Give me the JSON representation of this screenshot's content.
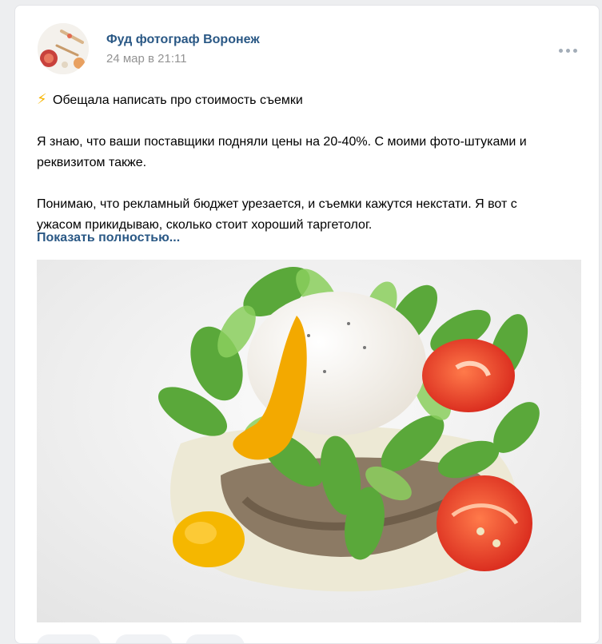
{
  "post": {
    "author": "Фуд фотограф Воронеж",
    "date": "24 мар в 21:11",
    "headline_emoji": "⚡",
    "lines": {
      "headline": "Обещала написать про стоимость съемки",
      "p1_l1": "Я знаю, что ваши поставщики подняли цены на 20-40%. С моими фото-штуками и",
      "p1_l2": "реквизитом также.",
      "p2_l1": "Понимаю, что рекламный бюджет урезается, и съемки кажутся некстати. Я вот с",
      "p2_l2": "ужасом прикидываю, сколько стоит хороший таргетолог."
    },
    "show_more": "Показать полностью..."
  },
  "icons": {
    "more": "more-horizontal-icon",
    "emoji": "lightning-icon"
  },
  "colors": {
    "link": "#2a5885",
    "secondary_text": "#939393",
    "page_bg": "#edeef0"
  }
}
